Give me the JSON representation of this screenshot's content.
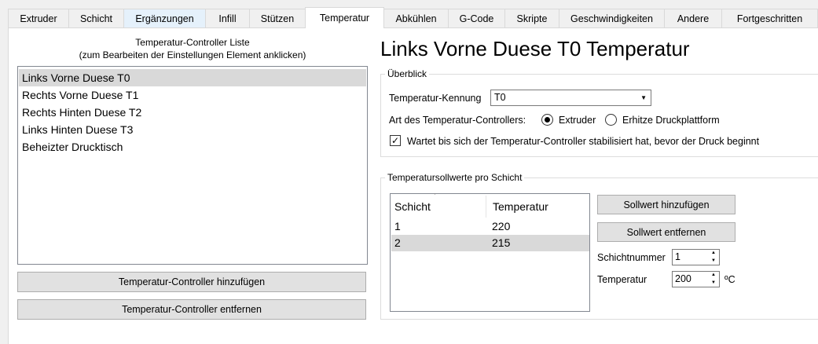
{
  "tabs": [
    {
      "label": "Extruder"
    },
    {
      "label": "Schicht"
    },
    {
      "label": "Ergänzungen"
    },
    {
      "label": "Infill"
    },
    {
      "label": "Stützen"
    },
    {
      "label": "Temperatur"
    },
    {
      "label": "Abkühlen"
    },
    {
      "label": "G-Code"
    },
    {
      "label": "Skripte"
    },
    {
      "label": "Geschwindigkeiten"
    },
    {
      "label": "Andere"
    },
    {
      "label": "Fortgeschritten"
    }
  ],
  "active_tab": "Temperatur",
  "left": {
    "list_title_line1": "Temperatur-Controller Liste",
    "list_title_line2": "(zum Bearbeiten der Einstellungen Element anklicken)",
    "controllers": [
      "Links Vorne Duese T0",
      "Rechts Vorne Duese T1",
      "Rechts Hinten Duese T2",
      "Links Hinten Duese T3",
      "Beheizter Drucktisch"
    ],
    "selected_controller": "Links Vorne Duese T0",
    "add_button": "Temperatur-Controller hinzufügen",
    "remove_button": "Temperatur-Controller entfernen"
  },
  "right": {
    "heading": "Links Vorne Duese T0 Temperatur",
    "overview": {
      "group_label": "Überblick",
      "id_label": "Temperatur-Kennung",
      "id_value": "T0",
      "type_label": "Art des Temperatur-Controllers:",
      "type_options": [
        "Extruder",
        "Erhitze Druckplattform"
      ],
      "type_selected": "Extruder",
      "stabilize_label": "Wartet bis sich der Temperatur-Controller stabilisiert hat, bevor der Druck beginnt",
      "stabilize_checked": true
    },
    "setpoints": {
      "group_label": "Temperatursollwerte pro Schicht",
      "columns": [
        "Schicht",
        "Temperatur"
      ],
      "rows": [
        {
          "layer": "1",
          "temp": "220"
        },
        {
          "layer": "2",
          "temp": "215"
        }
      ],
      "selected_row": 1,
      "add_button": "Sollwert hinzufügen",
      "remove_button": "Sollwert entfernen",
      "layer_label": "Schichtnummer",
      "layer_value": "1",
      "temp_label": "Temperatur",
      "temp_value": "200",
      "temp_unit": "ºC"
    }
  }
}
